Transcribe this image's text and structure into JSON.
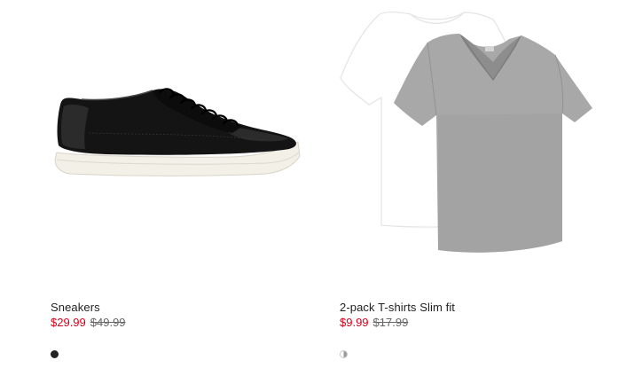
{
  "products": [
    {
      "name": "Sneakers",
      "sale_price": "$29.99",
      "original_price": "$49.99",
      "image_icon": "sneaker-image",
      "swatches": [
        {
          "label": "black",
          "color": "#222222"
        }
      ]
    },
    {
      "name": "2-pack T-shirts Slim fit",
      "sale_price": "$9.99",
      "original_price": "$17.99",
      "image_icon": "tshirt-pack-image",
      "swatches": [
        {
          "label": "white/grey",
          "color": "#9a9a9a"
        }
      ]
    }
  ],
  "colors": {
    "sale_price": "#d0021b",
    "original_price": "#666666",
    "text": "#222222"
  }
}
